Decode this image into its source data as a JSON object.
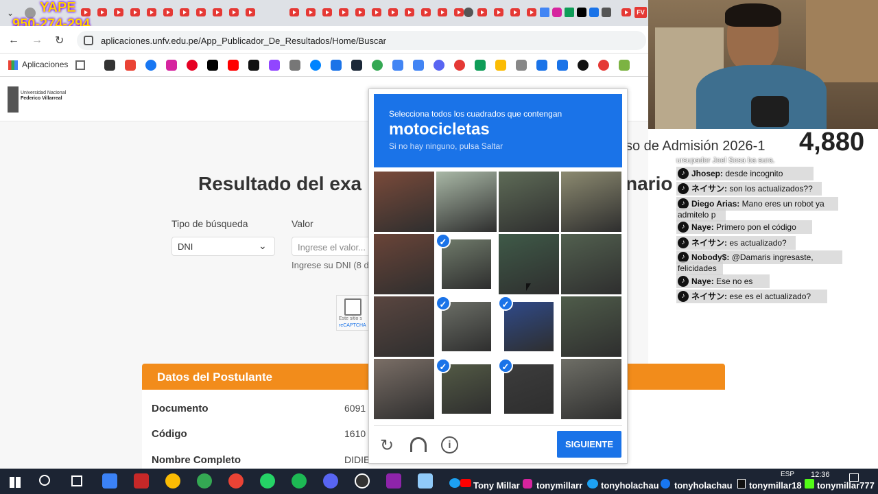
{
  "stream_overlay": {
    "yape_label": "YAPE",
    "yape_number": "950-274-294",
    "viewer_count": "4,880"
  },
  "browser": {
    "url": "aplicaciones.unfv.edu.pe/App_Publicador_De_Resultados/Home/Buscar",
    "bookmarks_label": "Aplicaciones"
  },
  "page": {
    "logo_line1": "Universidad Nacional",
    "logo_line2": "Federico Villarreal",
    "title_left": "Resultado del exa",
    "title_right": "nario",
    "proceso_title": "so de Admisión 2026-1",
    "tipo_label": "Tipo de búsqueda",
    "tipo_value": "DNI",
    "valor_label": "Valor",
    "valor_placeholder": "Ingrese el valor...",
    "valor_hint": "Ingrese su DNI (8 d",
    "recaptcha_small1": "Este sitio s",
    "recaptcha_small2": "reCAPTCHA",
    "datos_header": "Datos del Postulante",
    "rows": [
      {
        "label": "Documento",
        "value": "6091"
      },
      {
        "label": "Código",
        "value": "1610"
      },
      {
        "label": "Nombre Completo",
        "value": "DIDIE"
      }
    ]
  },
  "captcha": {
    "instruction": "Selecciona todos los cuadrados que contengan",
    "target": "motocicletas",
    "subtext": "Si no hay ninguno, pulsa Saltar",
    "submit_label": "SIGUIENTE",
    "tiles_selected": [
      false,
      false,
      false,
      false,
      false,
      true,
      false,
      false,
      false,
      true,
      true,
      false,
      false,
      true,
      true,
      false
    ]
  },
  "chat": {
    "top_line": "ursupador Joel Sosa ba sura.",
    "messages": [
      {
        "user": "Jhosep:",
        "text": "desde incognito"
      },
      {
        "user": "ネイサン:",
        "text": "son los actualizados??"
      },
      {
        "user": "Diego Arias:",
        "text": "Mano eres un robot ya"
      },
      {
        "user": "",
        "text": "admitelo p"
      },
      {
        "user": "Naye:",
        "text": "Primero pon el código"
      },
      {
        "user": "ネイサン:",
        "text": "es actualizado?"
      },
      {
        "user": "Nobody$:",
        "text": "@Damaris ingresaste,"
      },
      {
        "user": "",
        "text": "felicidades"
      },
      {
        "user": "Naye:",
        "text": "Ese no es"
      },
      {
        "user": "ネイサン:",
        "text": "ese es el actualizado?"
      }
    ]
  },
  "taskbar": {
    "tony_millar": "Tony Millar",
    "ig": "tonymillarr",
    "twitter": "tonyholachau",
    "fb": "tonyholachau",
    "tiktok": "tonymillar18",
    "kick": "tonymillar777",
    "time": "12:36",
    "lang": "ESP"
  },
  "colors": {
    "captcha_blue": "#1a73e8",
    "datos_orange": "#f28c1b"
  }
}
